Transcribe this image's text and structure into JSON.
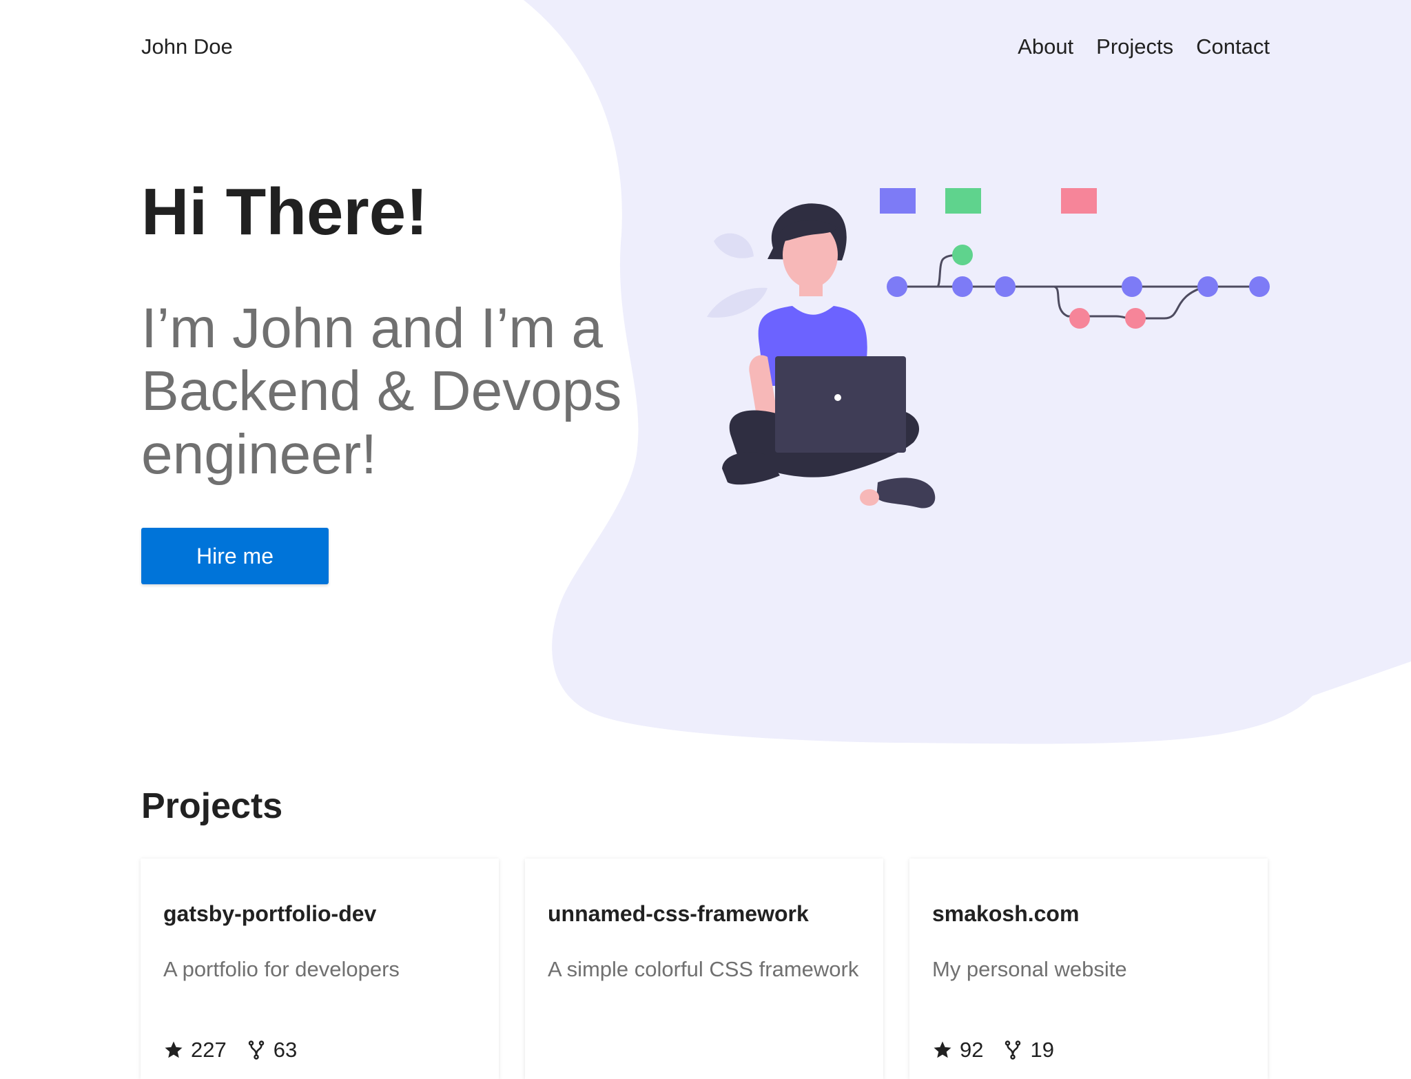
{
  "header": {
    "brand": "John Doe",
    "nav": [
      {
        "label": "About"
      },
      {
        "label": "Projects"
      },
      {
        "label": "Contact"
      }
    ]
  },
  "hero": {
    "title": "Hi There!",
    "subtitle": "I’m John and I’m a Backend & Devops engineer!",
    "cta_label": "Hire me"
  },
  "projects": {
    "title": "Projects",
    "cards": [
      {
        "name": "gatsby-portfolio-dev",
        "description": "A portfolio for developers",
        "stars": "227",
        "forks": "63"
      },
      {
        "name": "unnamed-css-framework",
        "description": "A simple colorful CSS framework",
        "stars": "",
        "forks": ""
      },
      {
        "name": "smakosh.com",
        "description": "My personal website",
        "stars": "92",
        "forks": "19"
      }
    ]
  },
  "colors": {
    "accent": "#0074d9",
    "blob": "#eeeefc",
    "purple": "#7d7bf6",
    "green": "#5fd38d",
    "pink": "#f68599",
    "dark": "#3f3d56"
  }
}
